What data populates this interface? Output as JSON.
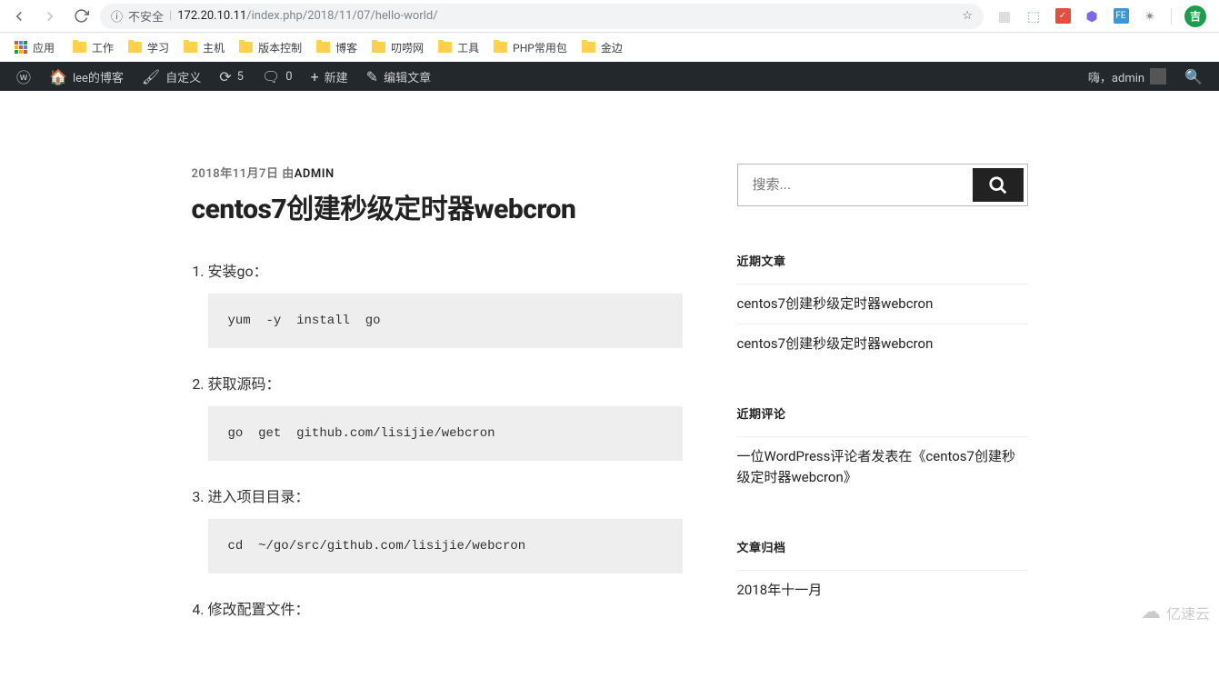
{
  "browser": {
    "insecure_label": "不安全",
    "url_host": "172.20.10.11",
    "url_path": "/index.php/2018/11/07/hello-world/",
    "avatar_letter": "吉"
  },
  "bookmarks": {
    "apps_label": "应用",
    "items": [
      "工作",
      "学习",
      "主机",
      "版本控制",
      "博客",
      "叨唠网",
      "工具",
      "PHP常用包",
      "金边"
    ]
  },
  "wp_bar": {
    "site_name": "lee的博客",
    "customize": "自定义",
    "updates_count": "5",
    "comments_count": "0",
    "new_label": "新建",
    "edit_label": "编辑文章",
    "howdy_prefix": "嗨，",
    "user": "admin"
  },
  "post": {
    "date": "2018年11月7日",
    "by": " 由",
    "author": "ADMIN",
    "title": "centos7创建秒级定时器webcron",
    "steps": [
      {
        "label": "安装go：",
        "code": "yum  -y  install  go"
      },
      {
        "label": "获取源码：",
        "code": "go  get  github.com/lisijie/webcron"
      },
      {
        "label": "进入项目目录：",
        "code": "cd  ~/go/src/github.com/lisijie/webcron"
      },
      {
        "label": "修改配置文件：",
        "code": ""
      }
    ]
  },
  "sidebar": {
    "search_placeholder": "搜索...",
    "recent_posts_title": "近期文章",
    "recent_posts": [
      "centos7创建秒级定时器webcron",
      "centos7创建秒级定时器webcron"
    ],
    "recent_comments_title": "近期评论",
    "recent_comments": [
      "一位WordPress评论者发表在《centos7创建秒级定时器webcron》"
    ],
    "archives_title": "文章归档",
    "archives": [
      "2018年十一月"
    ]
  },
  "watermark": "亿速云"
}
